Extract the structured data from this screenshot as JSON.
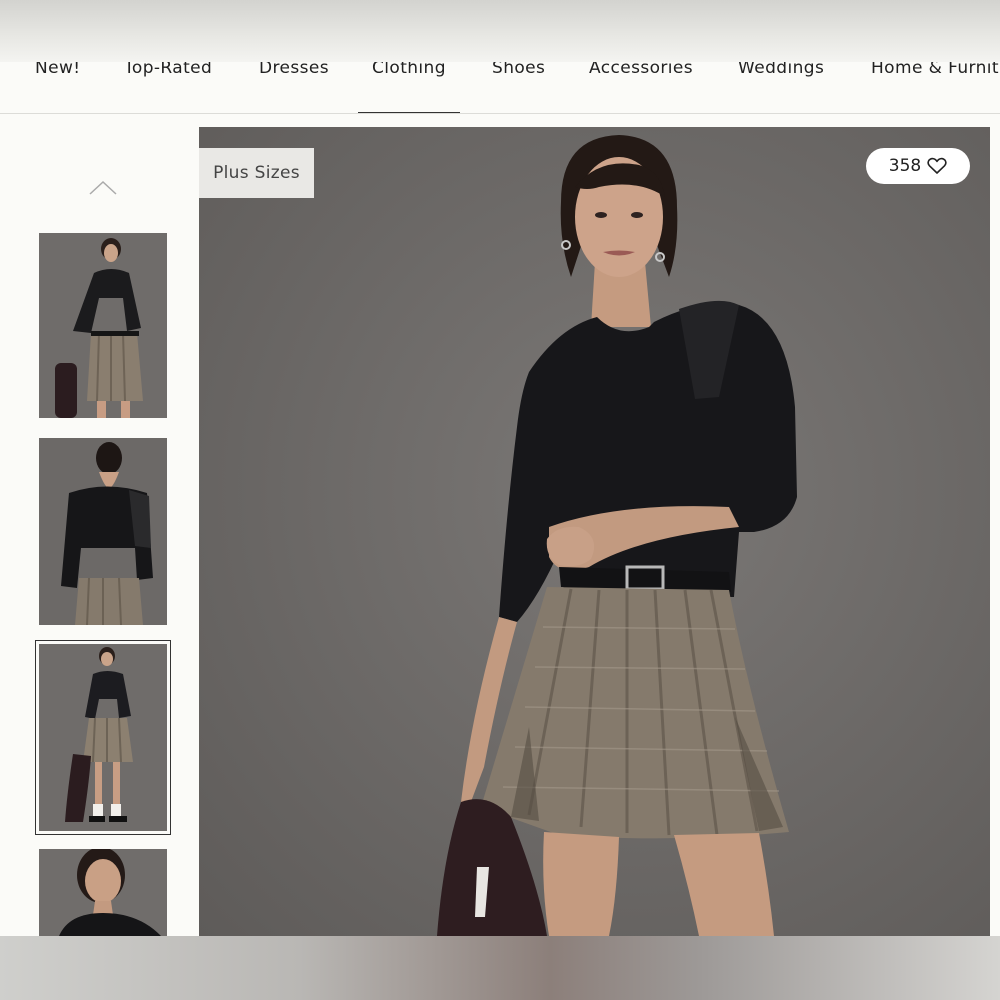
{
  "nav": {
    "items": [
      {
        "label": "New!"
      },
      {
        "label": "Top-Rated"
      },
      {
        "label": "Dresses"
      },
      {
        "label": "Clothing"
      },
      {
        "label": "Shoes"
      },
      {
        "label": "Accessories"
      },
      {
        "label": "Weddings"
      },
      {
        "label": "Home & Furnit"
      }
    ],
    "active": "Clothing"
  },
  "gallery": {
    "up_icon": "chevron-up-icon",
    "thumbnails": [
      {
        "alt": "model front view",
        "selected": false
      },
      {
        "alt": "model back view",
        "selected": false
      },
      {
        "alt": "model full length",
        "selected": true
      },
      {
        "alt": "model close-up",
        "selected": false
      }
    ]
  },
  "hero": {
    "badge": "Plus Sizes",
    "likes_count": "358",
    "likes_icon": "heart-icon"
  },
  "colors": {
    "background": "#6b6866",
    "page": "#fbfbf8",
    "active_underline": "#333333"
  }
}
